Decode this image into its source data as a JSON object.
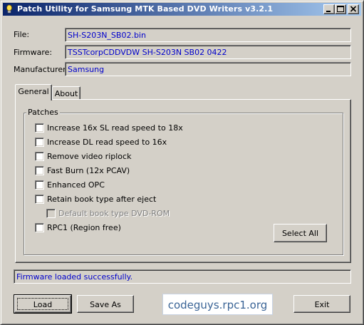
{
  "window": {
    "title": "Patch Utility for Samsung MTK Based DVD Writers v3.2.1",
    "icon": "lightbulb-icon"
  },
  "fields": {
    "file_label": "File:",
    "file_value": "SH-S203N_SB02.bin",
    "firmware_label": "Firmware:",
    "firmware_value": "TSSTcorpCDDVDW SH-S203N  SB02   0422",
    "manufacturer_label": "Manufacturer:",
    "manufacturer_value": "Samsung"
  },
  "tabs": [
    {
      "label": "General",
      "selected": true
    },
    {
      "label": "About",
      "selected": false
    }
  ],
  "patches": {
    "group_label": "Patches",
    "items": [
      {
        "label": "Increase 16x SL read speed to 18x",
        "checked": false,
        "enabled": true
      },
      {
        "label": "Increase DL read speed to 16x",
        "checked": false,
        "enabled": true
      },
      {
        "label": "Remove video riplock",
        "checked": false,
        "enabled": true
      },
      {
        "label": "Fast Burn (12x PCAV)",
        "checked": false,
        "enabled": true
      },
      {
        "label": "Enhanced OPC",
        "checked": false,
        "enabled": true
      },
      {
        "label": "Retain book type after eject",
        "checked": false,
        "enabled": true
      },
      {
        "label": "Default book type DVD-ROM",
        "checked": false,
        "enabled": false
      },
      {
        "label": "RPC1 (Region free)",
        "checked": false,
        "enabled": true
      }
    ],
    "select_all_label": "Select All"
  },
  "status": {
    "text": "Firmware loaded successfully."
  },
  "buttons": {
    "load": "Load",
    "save_as": "Save As",
    "logo_text": "codeguys.rpc1.org",
    "exit": "Exit"
  }
}
